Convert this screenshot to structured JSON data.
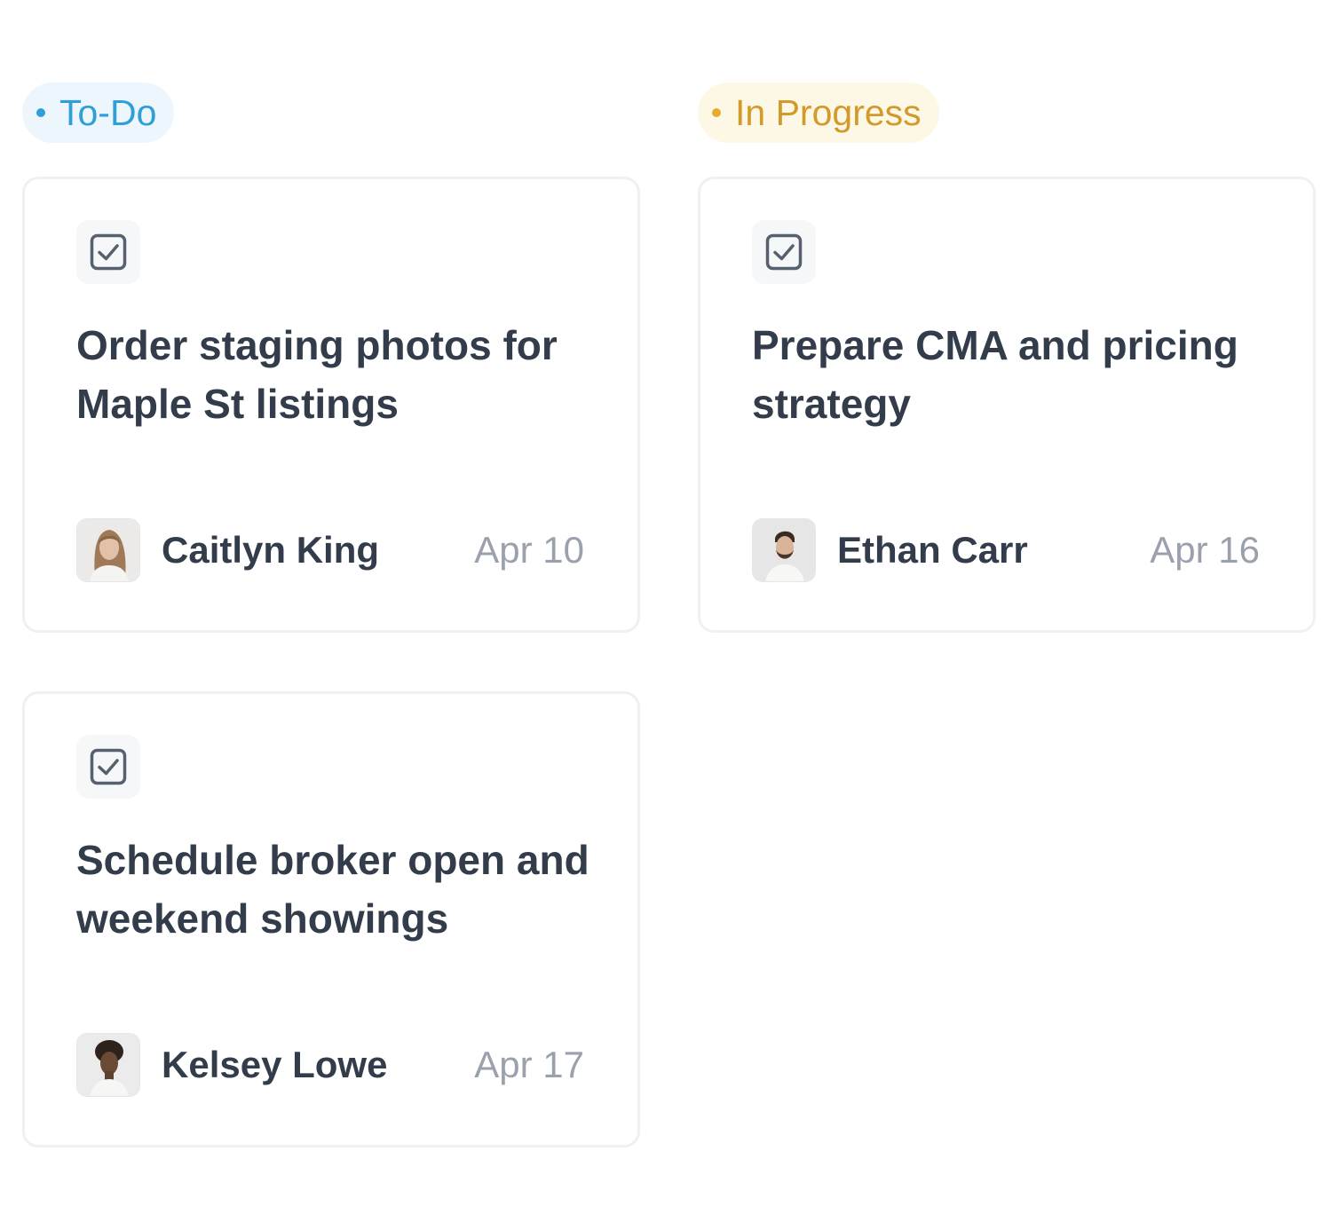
{
  "columns": [
    {
      "label": "To-Do",
      "text_color": "#2e9fd8",
      "bg_color": "#edf6fc",
      "dot_color": "#2e9fd8",
      "cards": [
        {
          "title": "Order staging photos for Maple St listings",
          "assignee": "Caitlyn King",
          "due": "Apr 10",
          "icon": "checkbox-icon",
          "avatar": "woman-portrait"
        },
        {
          "title": "Schedule broker open and weekend showings",
          "assignee": "Kelsey Lowe",
          "due": "Apr 17",
          "icon": "checkbox-icon",
          "avatar": "woman-portrait-curly"
        }
      ]
    },
    {
      "label": "In Progress",
      "text_color": "#d19a2a",
      "bg_color": "#fdf8e6",
      "dot_color": "#e7ac2c",
      "cards": [
        {
          "title": "Prepare CMA and pricing strategy",
          "assignee": "Ethan Carr",
          "due": "Apr 16",
          "icon": "checkbox-icon",
          "avatar": "man-portrait"
        }
      ]
    }
  ]
}
